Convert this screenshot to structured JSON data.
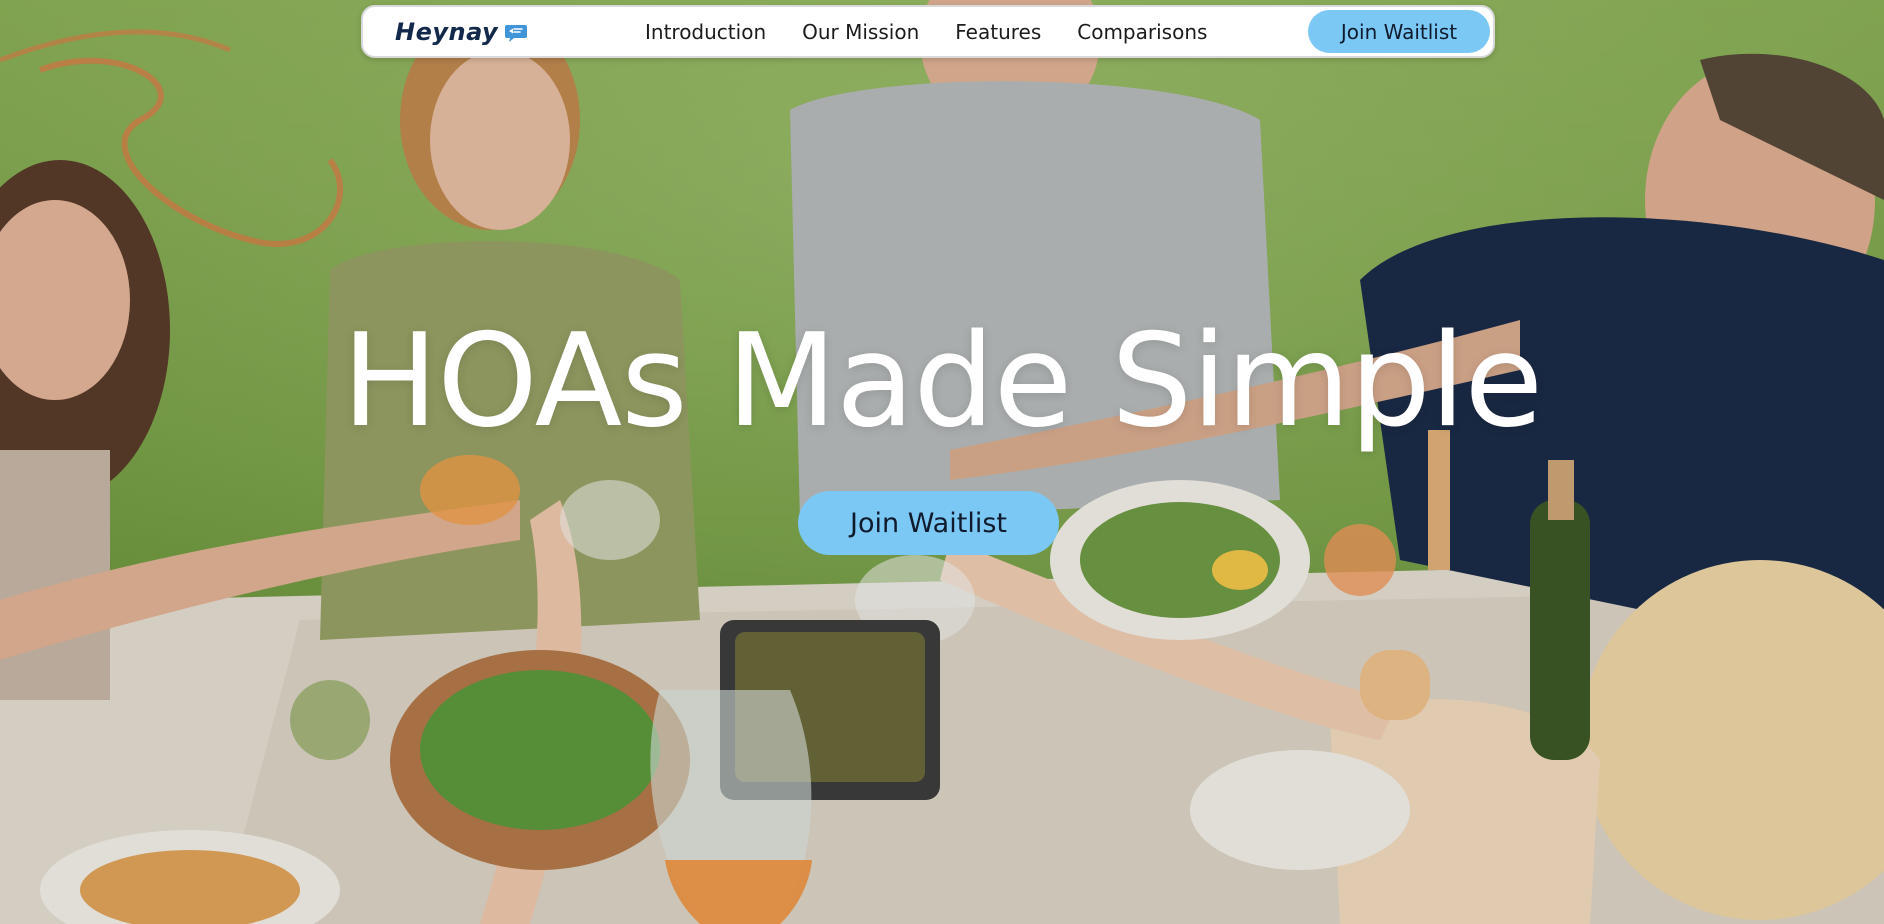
{
  "brand": {
    "name": "Heynay",
    "icon": "chat-bubble-icon"
  },
  "nav": {
    "links": [
      {
        "label": "Introduction"
      },
      {
        "label": "Our Mission"
      },
      {
        "label": "Features"
      },
      {
        "label": "Comparisons"
      }
    ],
    "cta_label": "Join Waitlist"
  },
  "hero": {
    "headline": "HOAs Made Simple",
    "cta_label": "Join Waitlist",
    "background_image": "family-dinner-toast-photo"
  },
  "colors": {
    "accent": "#7cc8f5",
    "brand_text": "#13294b",
    "headline": "#ffffff"
  }
}
